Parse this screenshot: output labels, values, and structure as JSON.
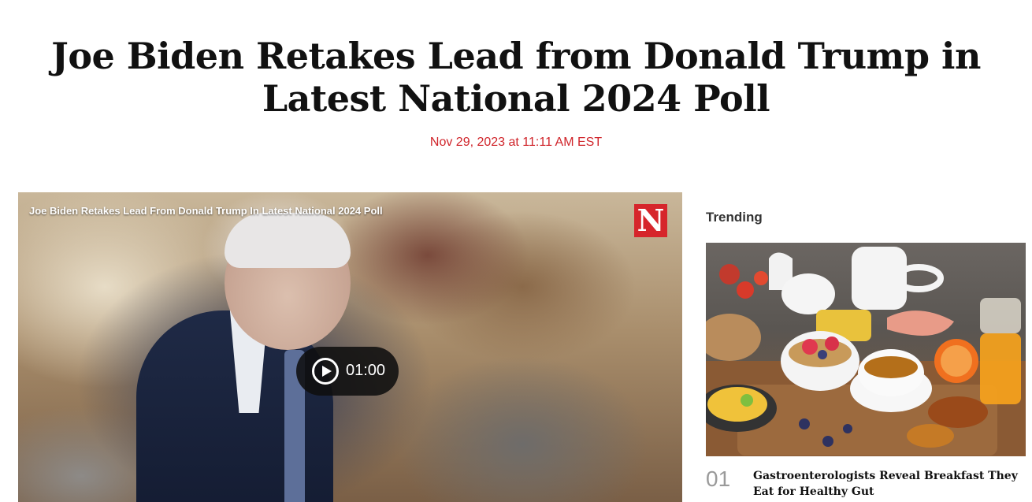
{
  "article": {
    "headline": "Joe Biden Retakes Lead from Donald Trump in Latest National 2024 Poll",
    "dateline": "Nov 29, 2023 at 11:11 AM EST"
  },
  "video": {
    "title": "Joe Biden Retakes Lead From Donald Trump In Latest National 2024 Poll",
    "logo_letter": "N",
    "duration": "01:00",
    "play_icon": "play-circle-icon"
  },
  "sidebar": {
    "heading": "Trending",
    "items": [
      {
        "number": "01",
        "title": "Gastroenterologists Reveal Breakfast They Eat for Healthy Gut"
      }
    ]
  },
  "colors": {
    "accent": "#d0242a",
    "logo": "#d6252b"
  }
}
